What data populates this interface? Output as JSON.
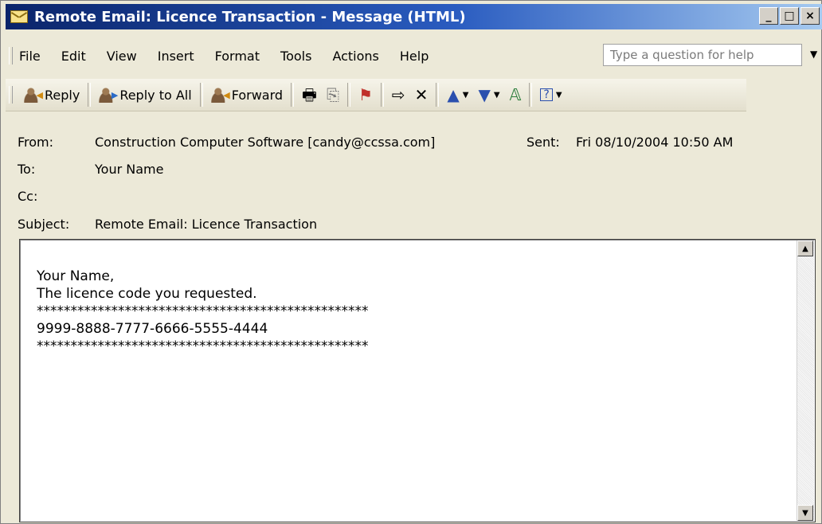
{
  "window": {
    "title": "Remote Email: Licence Transaction - Message (HTML)",
    "minimize_label": "_",
    "maximize_label": "□",
    "close_label": "×"
  },
  "menu": {
    "items": [
      {
        "label": "File"
      },
      {
        "label": "Edit"
      },
      {
        "label": "View"
      },
      {
        "label": "Insert"
      },
      {
        "label": "Format"
      },
      {
        "label": "Tools"
      },
      {
        "label": "Actions"
      },
      {
        "label": "Help"
      }
    ],
    "help_placeholder": "Type a question for help"
  },
  "toolbar": {
    "reply_label": "Reply",
    "reply_all_label": "Reply to All",
    "forward_label": "Forward",
    "icons": [
      "print-icon",
      "copy-icon",
      "flag-icon",
      "move-icon",
      "delete-icon",
      "previous-item-icon",
      "next-item-icon",
      "address-book-icon",
      "help-icon"
    ]
  },
  "header": {
    "from_label": "From:",
    "from_value": "Construction Computer Software [candy@ccssa.com]",
    "sent_label": "Sent:",
    "sent_value": "Fri 08/10/2004 10:50 AM",
    "to_label": "To:",
    "to_value": "Your Name",
    "cc_label": "Cc:",
    "cc_value": "",
    "subject_label": "Subject:",
    "subject_value": "Remote Email: Licence Transaction"
  },
  "body": {
    "greeting": "Your Name,",
    "line1": "The licence code you requested.",
    "stars1": "*************************************************",
    "code": "9999-8888-7777-6666-5555-4444",
    "stars2": "*************************************************"
  },
  "colors": {
    "titlebar_start": "#0a246a",
    "titlebar_end": "#a6caf0",
    "window_bg": "#ece9d8"
  }
}
